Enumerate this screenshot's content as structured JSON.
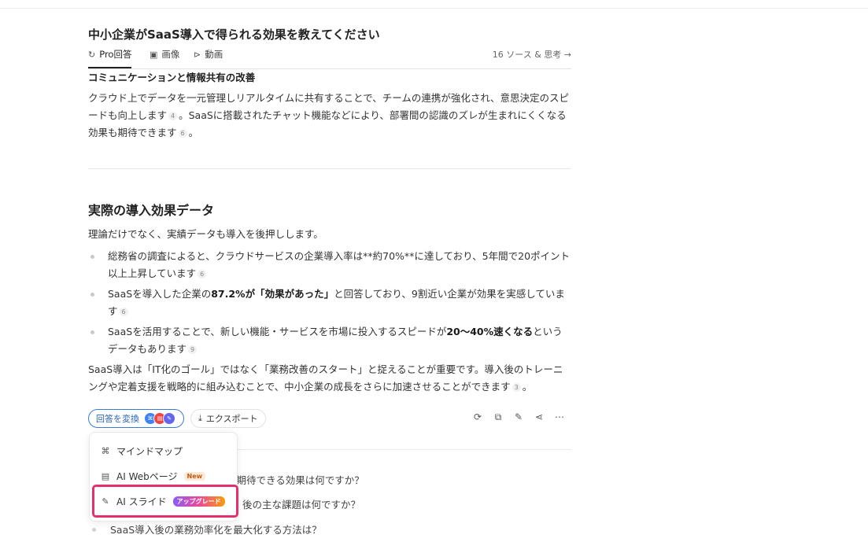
{
  "question": "中小企業がSaaS導入で得られる効果を教えてください",
  "tabs": [
    {
      "label": "Pro回答",
      "icon": "pro-search-icon"
    },
    {
      "label": "画像",
      "icon": "image-icon"
    },
    {
      "label": "動画",
      "icon": "video-icon"
    }
  ],
  "sources_link": "16 ソース & 思考 →",
  "section1": {
    "heading": "コミュニケーションと情報共有の改善",
    "para_a": "クラウド上でデータを一元管理しリアルタイムに共有することで、チームの連携が強化され、意思決定のスピードも向上します",
    "cite_a": "4",
    "para_b": "。SaaSに搭載されたチャット機能などにより、部署間の認識のズレが生まれにくくなる効果も期待できます",
    "cite_b": "6",
    "para_c": "。"
  },
  "section2": {
    "heading": "実際の導入効果データ",
    "intro": "理論だけでなく、実績データも導入を後押しします。",
    "bullet1": {
      "text": "総務省の調査によると、クラウドサービスの企業導入率は**約70%**に達しており、5年間で20ポイント以上上昇しています",
      "cite": "6"
    },
    "bullet2": {
      "pre": "SaaSを導入した企業の",
      "bold": "87.2%が「効果があった」",
      "post": "と回答しており、9割近い企業が効果を実感しています",
      "cite": "6"
    },
    "bullet3": {
      "pre": "SaaSを活用することで、新しい機能・サービスを市場に投入するスピードが",
      "bold": "20〜40%速くなる",
      "post": "というデータもあります",
      "cite": "9"
    },
    "closing": "SaaS導入は「IT化のゴール」ではなく「業務改善のスタート」と捉えることが重要です。導入後のトレーニングや定着支援を戦略的に組み込むことで、中小企業の成長をさらに加速させることができます",
    "closing_cite": "3",
    "closing_end": "。"
  },
  "actions": {
    "convert_label": "回答を変換",
    "export_label": "エクスポート",
    "avatar_colors": [
      "#3b82f6",
      "#ef4444",
      "#6366f1"
    ],
    "tools": [
      "refresh-icon",
      "copy-icon",
      "edit-icon",
      "share-icon",
      "more-icon"
    ]
  },
  "menu": {
    "items": [
      {
        "label": "マインドマップ",
        "icon": "mindmap-icon"
      },
      {
        "label": "AI Webページ",
        "icon": "webpage-icon",
        "badge": "New"
      },
      {
        "label": "AI スライド",
        "icon": "slide-icon",
        "badge": "アップグレード"
      }
    ]
  },
  "related": [
    "に期待できる効果は何ですか？",
    "後の主な課題は何ですか？",
    "SaaS導入後の業務効率化を最大化する方法は？"
  ],
  "colors": {
    "accent": "#3a7bd5",
    "highlight": "#e4306d"
  }
}
